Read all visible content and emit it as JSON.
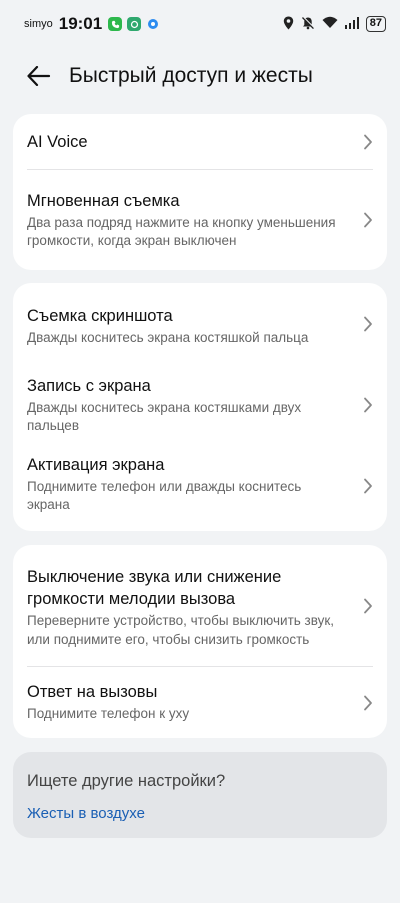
{
  "status": {
    "carrier": "simyo",
    "time": "19:01",
    "battery": "87"
  },
  "header": {
    "title": "Быстрый доступ и жесты"
  },
  "card1": [
    {
      "label": "AI Voice",
      "desc": ""
    },
    {
      "label": "Мгновенная съемка",
      "desc": "Два раза подряд нажмите на кнопку уменьшения громкости, когда экран выключен"
    }
  ],
  "card2": [
    {
      "label": "Съемка скриншота",
      "desc": "Дважды коснитесь экрана костяшкой пальца"
    },
    {
      "label": "Запись с экрана",
      "desc": "Дважды коснитесь экрана костяшками двух пальцев"
    },
    {
      "label": "Активация экрана",
      "desc": "Поднимите телефон или дважды коснитесь экрана"
    }
  ],
  "card3": [
    {
      "label": "Выключение звука или снижение громкости мелодии вызова",
      "desc": "Переверните устройство, чтобы выключить звук, или поднимите его, чтобы снизить громкость"
    },
    {
      "label": "Ответ на вызовы",
      "desc": "Поднимите телефон к уху"
    }
  ],
  "suggest": {
    "question": "Ищете другие настройки?",
    "link": "Жесты в воздухе"
  }
}
